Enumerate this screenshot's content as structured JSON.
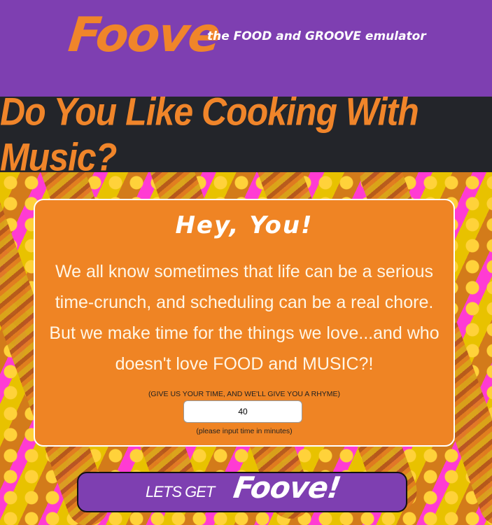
{
  "header": {
    "logo": "Foove",
    "tagline": "the FOOD and GROOVE emulator"
  },
  "banner": {
    "title": "Do You Like Cooking With Music?"
  },
  "card": {
    "title": "Hey, You!",
    "body": "We all know sometimes that life can be a serious time-crunch, and scheduling can be a real chore. But we make time for the things we love...and who doesn't love FOOD and MUSIC?!",
    "prompt": "(GIVE US YOUR TIME, AND WE'LL GIVE YOU A RHYME)",
    "input_value": "40",
    "hint": "(please input time in minutes)"
  },
  "cta": {
    "lead": "LETS GET",
    "brand": "Foove!"
  },
  "colors": {
    "header_bg": "#7e3fb1",
    "banner_bg": "#23252a",
    "accent_orange": "#f0852a",
    "card_bg": "#ef8424"
  }
}
